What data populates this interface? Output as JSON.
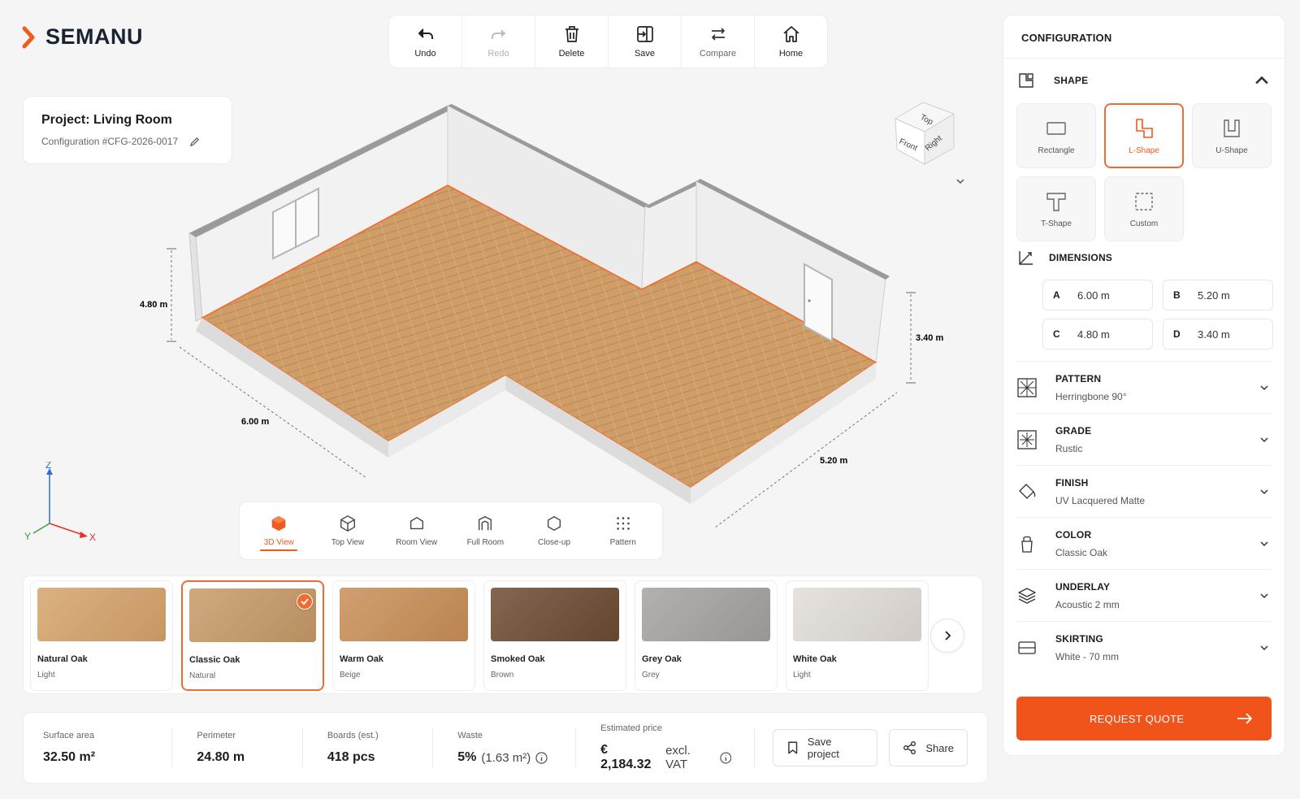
{
  "brand": {
    "name": "SEMANU",
    "accent": "#f05a1a"
  },
  "toolbar": [
    {
      "label": "Undo",
      "icon": "undo-icon",
      "state": "enabled"
    },
    {
      "label": "Redo",
      "icon": "redo-icon",
      "state": "disabled"
    },
    {
      "label": "Delete",
      "icon": "trash-icon",
      "state": "enabled"
    },
    {
      "label": "Save",
      "icon": "save-icon",
      "state": "enabled"
    },
    {
      "label": "Compare",
      "icon": "compare-icon",
      "state": "muted"
    },
    {
      "label": "Home",
      "icon": "home-icon",
      "state": "enabled"
    }
  ],
  "project": {
    "title": "Project: Living Room",
    "config_id": "Configuration #CFG-2026-0017"
  },
  "viewport": {
    "dimensions": {
      "left_height": "4.80 m",
      "left_length": "6.00 m",
      "right_length": "5.20 m",
      "right_height": "3.40 m"
    },
    "view_cube": {
      "top": "Top",
      "front": "Front",
      "right": "Right"
    },
    "axes": {
      "x": "X",
      "y": "Y",
      "z": "Z"
    }
  },
  "view_modes": [
    {
      "label": "3D View",
      "icon": "cube-solid-icon",
      "active": true
    },
    {
      "label": "Top View",
      "icon": "cube-outline-icon",
      "active": false
    },
    {
      "label": "Room View",
      "icon": "room-icon",
      "active": false
    },
    {
      "label": "Full Room",
      "icon": "full-room-icon",
      "active": false
    },
    {
      "label": "Close-up",
      "icon": "hexagon-icon",
      "active": false
    },
    {
      "label": "Pattern",
      "icon": "pattern-grid-icon",
      "active": false
    }
  ],
  "materials": [
    {
      "name": "Natural Oak",
      "tone": "Light",
      "color": "#d6a46c",
      "selected": false
    },
    {
      "name": "Classic Oak",
      "tone": "Natural",
      "color": "#c79a68",
      "selected": true
    },
    {
      "name": "Warm Oak",
      "tone": "Beige",
      "color": "#c98f57",
      "selected": false
    },
    {
      "name": "Smoked Oak",
      "tone": "Brown",
      "color": "#6d4c33",
      "selected": false
    },
    {
      "name": "Grey Oak",
      "tone": "Grey",
      "color": "#a5a3a1",
      "selected": false
    },
    {
      "name": "White Oak",
      "tone": "Light",
      "color": "#e2ddd7",
      "selected": false
    }
  ],
  "stats": [
    {
      "label": "Surface area",
      "value": "32.50 m²"
    },
    {
      "label": "Perimeter",
      "value": "24.80 m"
    },
    {
      "label": "Boards (est.)",
      "value": "418 pcs"
    },
    {
      "label": "Waste",
      "value": "5%",
      "extra": "(1.63 m²)"
    },
    {
      "label": "Estimated price",
      "value": "€ 2,184.32",
      "extra": "excl. VAT"
    }
  ],
  "actions": {
    "save_project": "Save project",
    "share": "Share"
  },
  "config": {
    "title": "CONFIGURATION",
    "shape": {
      "title": "SHAPE",
      "options": [
        {
          "label": "Rectangle",
          "active": false
        },
        {
          "label": "L-Shape",
          "active": true
        },
        {
          "label": "U-Shape",
          "active": false
        },
        {
          "label": "T-Shape",
          "active": false
        },
        {
          "label": "Custom",
          "active": false
        }
      ]
    },
    "dimensions": {
      "title": "DIMENSIONS",
      "fields": [
        {
          "key": "A",
          "value": "6.00 m"
        },
        {
          "key": "B",
          "value": "5.20 m"
        },
        {
          "key": "C",
          "value": "4.80 m"
        },
        {
          "key": "D",
          "value": "3.40 m"
        }
      ]
    },
    "sections": [
      {
        "title": "PATTERN",
        "value": "Herringbone 90°",
        "icon": "pattern-icon"
      },
      {
        "title": "GRADE",
        "value": "Rustic",
        "icon": "grade-icon"
      },
      {
        "title": "FINISH",
        "value": "UV Lacquered Matte",
        "icon": "finish-bucket-icon"
      },
      {
        "title": "COLOR",
        "value": "Classic Oak",
        "icon": "color-drop-icon"
      },
      {
        "title": "UNDERLAY",
        "value": "Acoustic 2 mm",
        "icon": "layers-icon"
      },
      {
        "title": "SKIRTING",
        "value": "White - 70 mm",
        "icon": "skirting-icon"
      }
    ],
    "cta": "REQUEST QUOTE"
  }
}
